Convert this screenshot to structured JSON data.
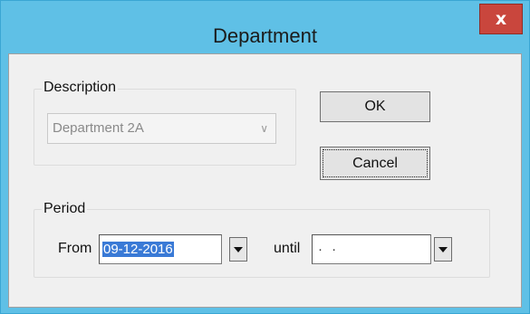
{
  "window": {
    "title": "Department",
    "close_label": "x"
  },
  "description_group": {
    "label": "Description",
    "combo_value": "Department 2A"
  },
  "buttons": {
    "ok_label": "OK",
    "cancel_label": "Cancel"
  },
  "period_group": {
    "label": "Period",
    "from_label": "From",
    "from_value": "09-12-2016",
    "until_label": "until",
    "until_value": "· ·"
  }
}
